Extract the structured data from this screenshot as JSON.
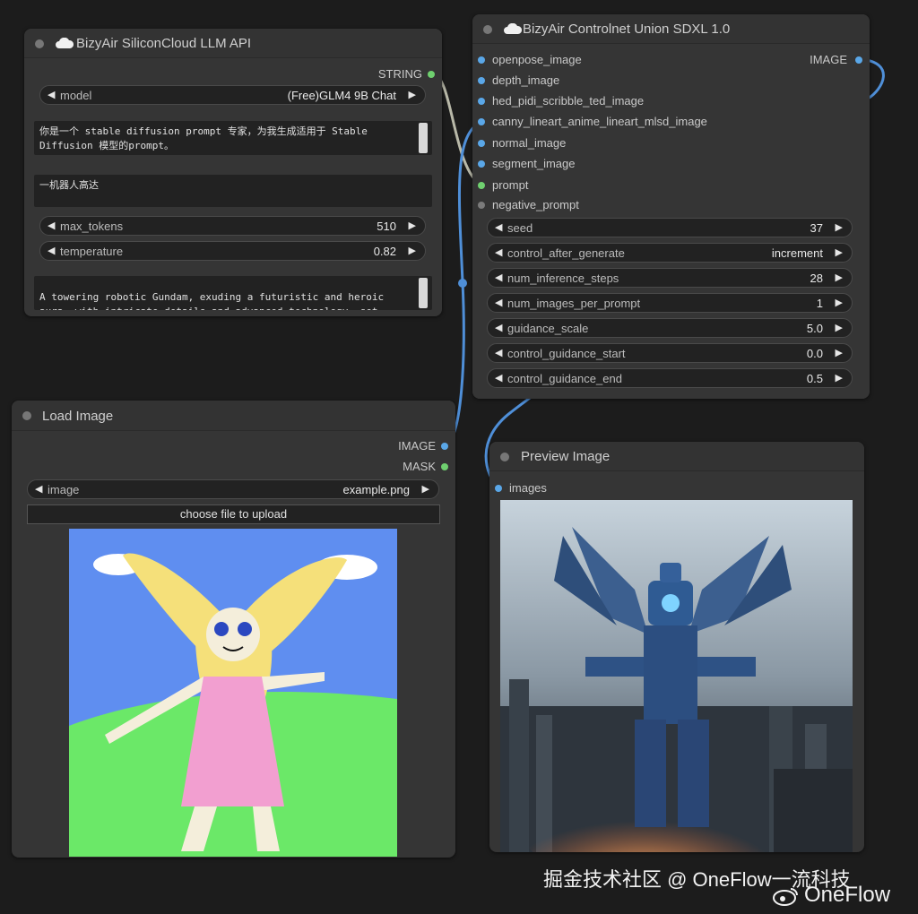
{
  "llm_node": {
    "title": "BizyAir SiliconCloud LLM API",
    "output_string": "STRING",
    "model": {
      "label": "model",
      "value": "(Free)GLM4 9B Chat"
    },
    "system_prompt": "你是一个 stable diffusion prompt 专家，为我生成适用于 Stable\nDiffusion 模型的prompt。",
    "user_prompt": "一机器人高达",
    "max_tokens": {
      "label": "max_tokens",
      "value": "510"
    },
    "temperature": {
      "label": "temperature",
      "value": "0.82"
    },
    "output_text": "A towering robotic Gundam, exuding a futuristic and heroic\naura, with intricate details and advanced technology, set"
  },
  "controlnet_node": {
    "title": "BizyAir Controlnet Union SDXL 1.0",
    "output_image": "IMAGE",
    "inputs": [
      "openpose_image",
      "depth_image",
      "hed_pidi_scribble_ted_image",
      "canny_lineart_anime_lineart_mlsd_image",
      "normal_image",
      "segment_image",
      "prompt",
      "negative_prompt"
    ],
    "widgets": [
      {
        "label": "seed",
        "value": "37"
      },
      {
        "label": "control_after_generate",
        "value": "increment"
      },
      {
        "label": "num_inference_steps",
        "value": "28"
      },
      {
        "label": "num_images_per_prompt",
        "value": "1"
      },
      {
        "label": "guidance_scale",
        "value": "5.0"
      },
      {
        "label": "control_guidance_start",
        "value": "0.0"
      },
      {
        "label": "control_guidance_end",
        "value": "0.5"
      }
    ]
  },
  "load_image_node": {
    "title": "Load Image",
    "output_image": "IMAGE",
    "output_mask": "MASK",
    "image_widget": {
      "label": "image",
      "value": "example.png"
    },
    "upload_button": "choose file to upload"
  },
  "preview_node": {
    "title": "Preview Image",
    "input_images": "images"
  },
  "watermark": {
    "line1": "掘金技术社区 @ OneFlow一流科技",
    "line2": "OneFlow"
  },
  "icons": {
    "arrow_left": "◀",
    "arrow_right": "▶"
  },
  "colors": {
    "background": "#1c1c1c",
    "node": "#353535",
    "slot_blue": "#5aa7e8",
    "slot_green": "#6fd06f",
    "wire_blue": "#4f8fd8"
  }
}
